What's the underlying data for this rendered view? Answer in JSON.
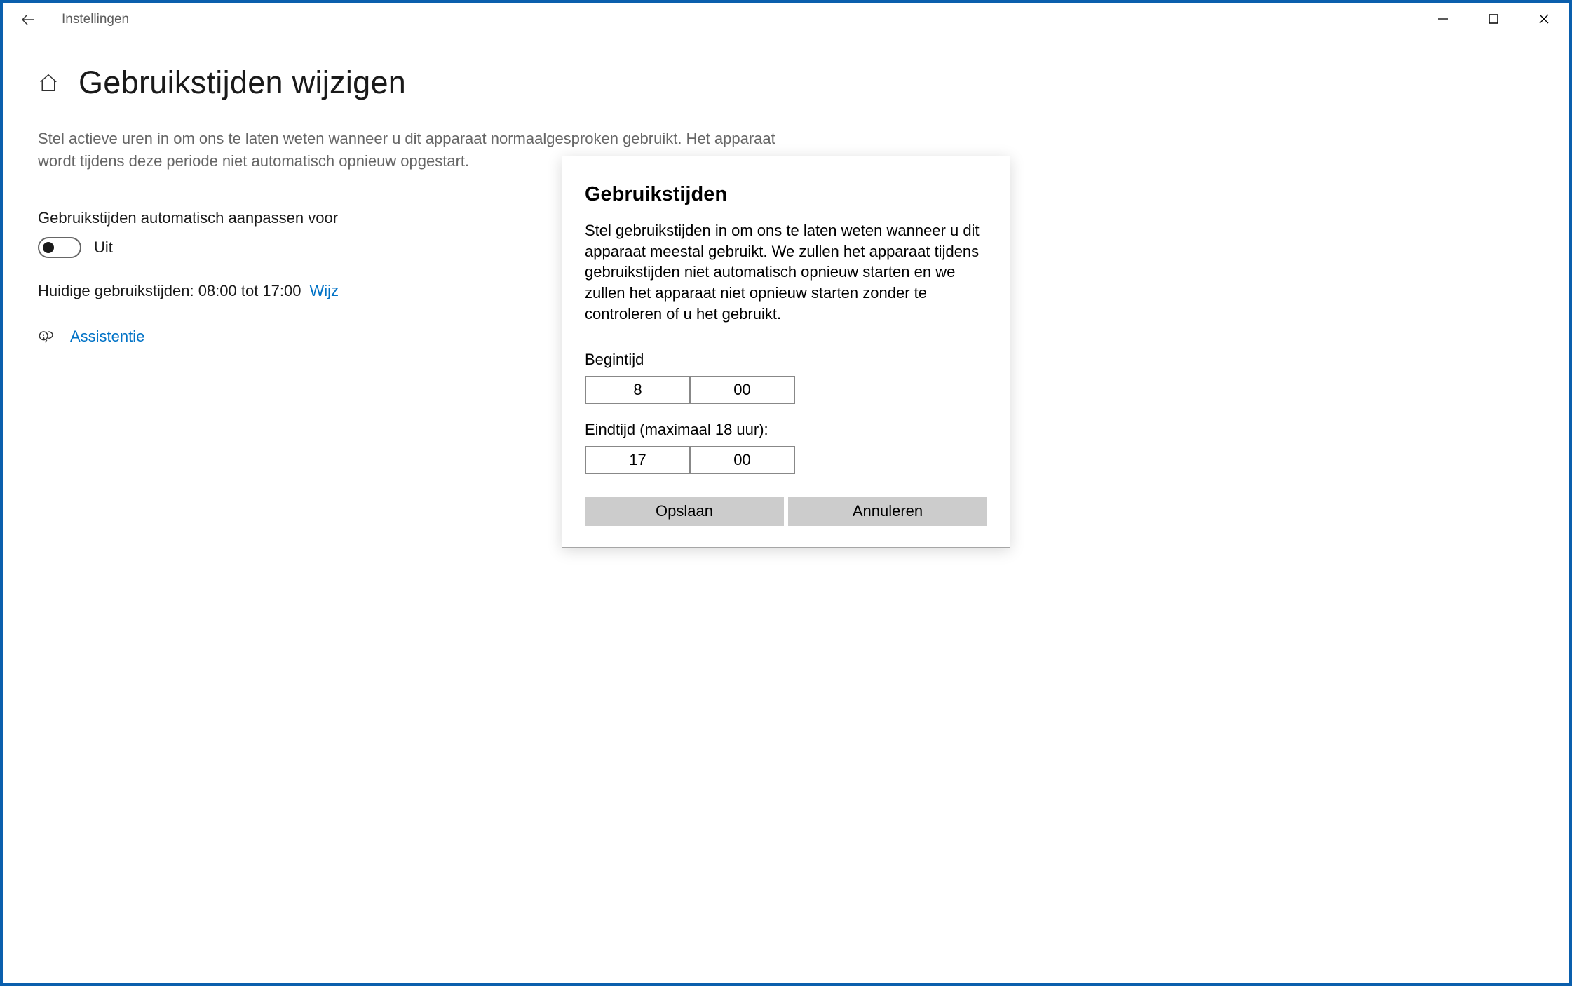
{
  "window": {
    "app_name": "Instellingen"
  },
  "header": {
    "title": "Gebruikstijden wijzigen"
  },
  "main": {
    "description": "Stel actieve uren in om ons te laten weten wanneer u dit apparaat normaalgesproken gebruikt. Het apparaat wordt tijdens deze periode niet automatisch opnieuw opgestart.",
    "auto_adjust_label": "Gebruikstijden automatisch aanpassen voor",
    "toggle_state": "Uit",
    "current_hours_text": "Huidige gebruikstijden: 08:00 tot 17:00",
    "change_link": "Wijz",
    "help_link": "Assistentie"
  },
  "modal": {
    "title": "Gebruikstijden",
    "description": "Stel gebruikstijden in om ons te laten weten wanneer u dit apparaat meestal gebruikt. We zullen het apparaat tijdens gebruikstijden niet automatisch opnieuw starten en we zullen het apparaat niet opnieuw starten zonder te controleren of u het gebruikt.",
    "start_label": "Begintijd",
    "start_hour": "8",
    "start_minute": "00",
    "end_label": "Eindtijd (maximaal 18 uur):",
    "end_hour": "17",
    "end_minute": "00",
    "save_label": "Opslaan",
    "cancel_label": "Annuleren"
  }
}
